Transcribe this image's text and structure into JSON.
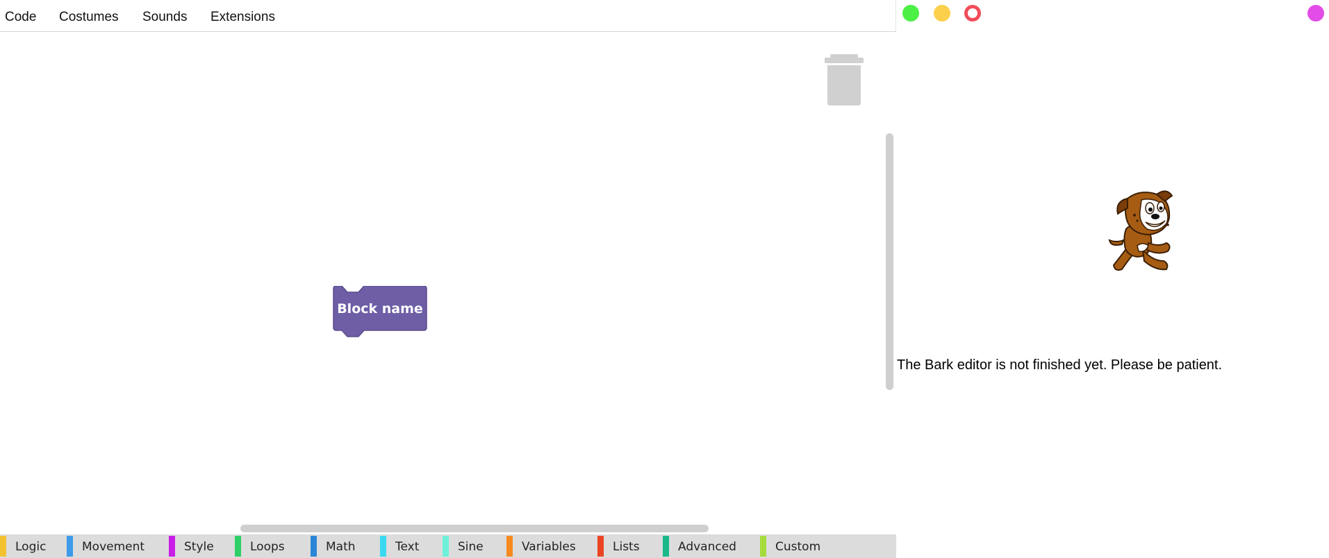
{
  "tabs": [
    {
      "label": "Code"
    },
    {
      "label": "Costumes"
    },
    {
      "label": "Sounds"
    },
    {
      "label": "Extensions"
    }
  ],
  "workspace": {
    "block": {
      "label": "Block name",
      "color": "#6e5ea6"
    },
    "trash_icon": "trash-can-icon"
  },
  "categories": [
    {
      "label": "Logic",
      "color": "#f2c230"
    },
    {
      "label": "Movement",
      "color": "#3d9be9"
    },
    {
      "label": "Style",
      "color": "#c91ee8"
    },
    {
      "label": "Loops",
      "color": "#2ecf66"
    },
    {
      "label": "Math",
      "color": "#2a86d6"
    },
    {
      "label": "Text",
      "color": "#3ad9f0"
    },
    {
      "label": "Sine",
      "color": "#6ff0da"
    },
    {
      "label": "Variables",
      "color": "#f58a1f"
    },
    {
      "label": "Lists",
      "color": "#ea4523"
    },
    {
      "label": "Advanced",
      "color": "#1ab88a"
    },
    {
      "label": "Custom",
      "color": "#a6db3c"
    }
  ],
  "stage": {
    "controls": [
      {
        "name": "go",
        "color": "#4cf045"
      },
      {
        "name": "pause",
        "color": "#fcd04c"
      },
      {
        "name": "stop",
        "color": "#f04d5a"
      },
      {
        "name": "extra",
        "color": "#e14de6"
      }
    ],
    "sprite_icon": "dog-sprite-icon",
    "message": "The Bark editor is not finished yet. Please be patient."
  }
}
